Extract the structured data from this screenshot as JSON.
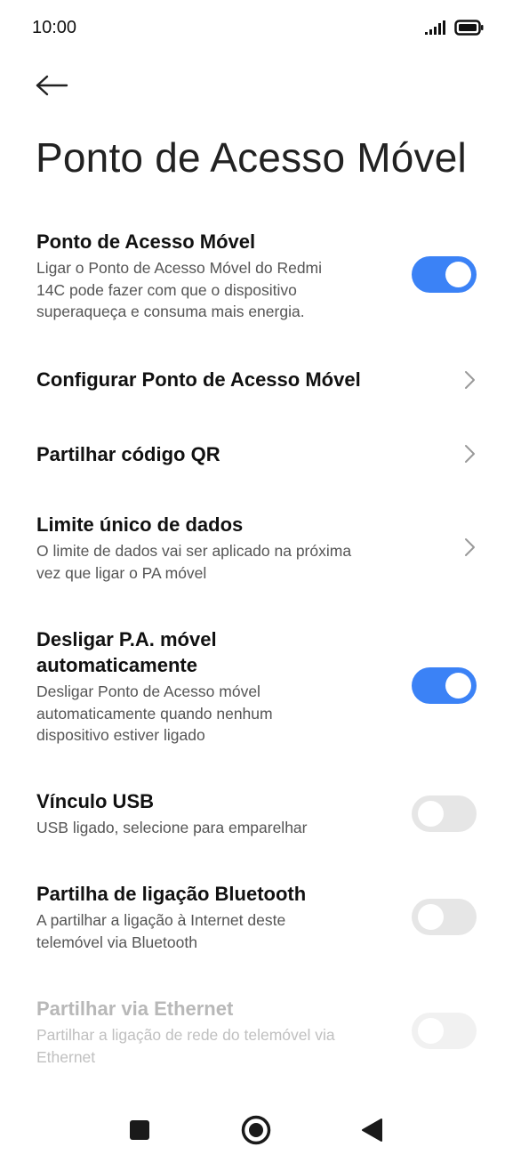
{
  "status": {
    "time": "10:00",
    "signal_icon": "signal-icon",
    "battery_icon": "battery-icon"
  },
  "header": {
    "back_icon": "arrow-left-icon",
    "title": "Ponto de Acesso Móvel"
  },
  "settings": [
    {
      "id": "hotspot",
      "title": "Ponto de Acesso Móvel",
      "desc_lines": [
        "Ligar o Ponto de Acesso Móvel do Redmi",
        "14C pode fazer com que o dispositivo",
        "superaqueça e consuma mais energia."
      ],
      "control": "toggle",
      "on": true
    },
    {
      "id": "configure",
      "title": "Configurar Ponto de Acesso Móvel",
      "control": "chevron"
    },
    {
      "id": "share-qr",
      "title": "Partilhar código QR",
      "control": "chevron"
    },
    {
      "id": "data-limit",
      "title": "Limite único de dados",
      "desc_lines": [
        "O limite de dados vai ser aplicado na próxima",
        "vez que ligar o PA móvel"
      ],
      "control": "chevron"
    },
    {
      "id": "auto-off",
      "title_lines": [
        "Desligar P.A. móvel",
        "automaticamente"
      ],
      "desc_lines": [
        "Desligar Ponto de Acesso móvel",
        "automaticamente quando nenhum",
        "dispositivo estiver ligado"
      ],
      "control": "toggle",
      "on": true
    },
    {
      "id": "usb",
      "title": "Vínculo USB",
      "desc_lines": [
        "USB ligado, selecione para emparelhar"
      ],
      "control": "toggle",
      "on": false
    },
    {
      "id": "bluetooth",
      "title": "Partilha de ligação Bluetooth",
      "desc_lines": [
        "A partilhar a ligação à Internet deste",
        "telemóvel via Bluetooth"
      ],
      "control": "toggle",
      "on": false
    },
    {
      "id": "ethernet",
      "title": "Partilhar via Ethernet",
      "desc_lines": [
        "Partilhar a ligação de rede do telemóvel via",
        "Ethernet"
      ],
      "control": "toggle",
      "on": false,
      "disabled": true
    }
  ],
  "nav": {
    "recents_icon": "square-icon",
    "home_icon": "circle-home-icon",
    "back_icon": "triangle-back-icon"
  },
  "colors": {
    "accent": "#3b82f6",
    "toggle_off": "#e6e6e6",
    "text_primary": "#111111",
    "text_secondary": "#555555",
    "text_disabled": "#b8b8b8"
  }
}
